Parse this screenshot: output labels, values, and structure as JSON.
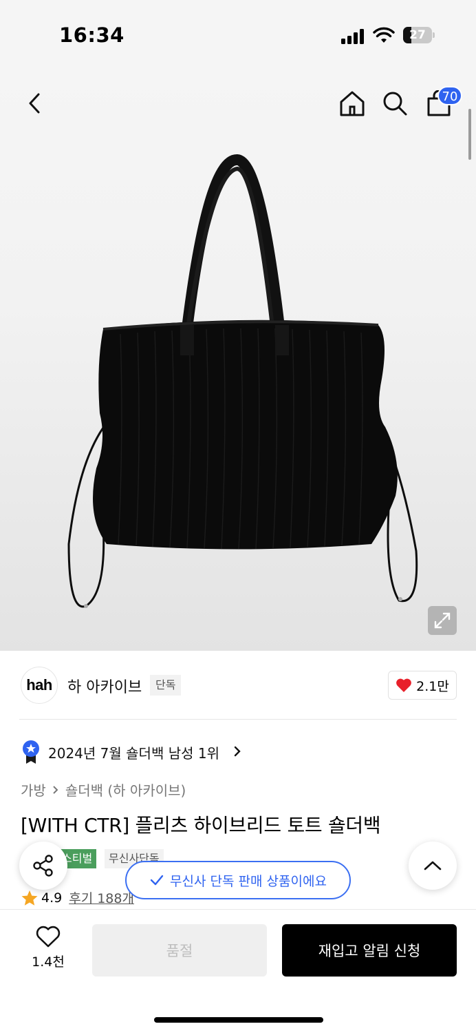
{
  "status_bar": {
    "time": "16:34",
    "battery_level": "27"
  },
  "header": {
    "cart_count": "70",
    "icons": [
      "back-icon",
      "home-icon",
      "search-icon",
      "shopping-bag-icon"
    ]
  },
  "brand": {
    "logo_text": "hah",
    "name": "하 아카이브",
    "tag": "단독",
    "likes": "2.1만"
  },
  "ranking": {
    "text": "2024년 7월 숄더백 남성 1위"
  },
  "breadcrumb": {
    "level1": "가방",
    "level2": "숄더백 (하 아카이브)"
  },
  "product": {
    "title": "[WITH CTR] 플리츠 하이브리드 토트 숄더백",
    "tags": [
      "스티벌",
      "무신사단독"
    ],
    "rating": "4.9",
    "reviews": "후기 188개"
  },
  "toast": {
    "text": "무신사 단독 판매 상품이에요"
  },
  "bottom": {
    "wish_count": "1.4천",
    "soldout_label": "품절",
    "restock_label": "재입고 알림 신청"
  },
  "colors": {
    "accent_blue": "#2f63f0",
    "festival_green": "#4a9e5c",
    "heart_red": "#e8202a",
    "star_orange": "#f5a623"
  }
}
